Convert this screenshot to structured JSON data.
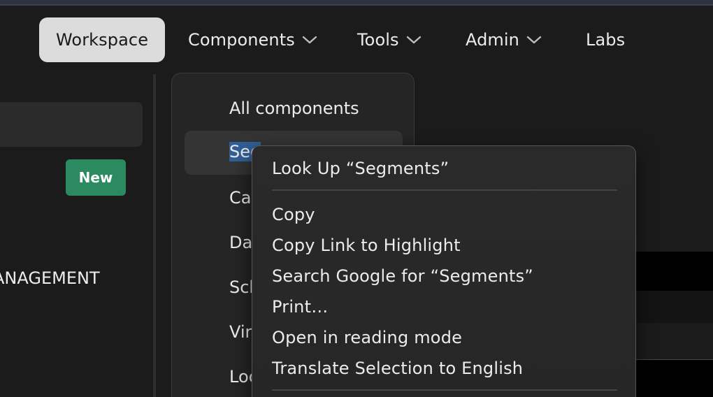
{
  "nav": {
    "items": [
      {
        "label": "Workspace",
        "active": true
      },
      {
        "label": "Components",
        "dropdown": true
      },
      {
        "label": "Tools",
        "dropdown": true
      },
      {
        "label": "Admin",
        "dropdown": true
      },
      {
        "label": "Labs"
      }
    ]
  },
  "sidebar": {
    "new_button": "New",
    "section_label": "ANAGEMENT"
  },
  "components_menu": {
    "items": [
      {
        "label": "All components"
      },
      {
        "label": "Seg",
        "selected_text": "Segments",
        "highlighted": true
      },
      {
        "label": "Cal"
      },
      {
        "label": "Dat"
      },
      {
        "label": "Sch"
      },
      {
        "label": "Vir"
      },
      {
        "label": "Loc"
      }
    ]
  },
  "context_menu": {
    "items": [
      {
        "label": "Look Up “Segments”"
      },
      {
        "label": "Copy"
      },
      {
        "label": "Copy Link to Highlight"
      },
      {
        "label": "Search Google for “Segments”"
      },
      {
        "label": "Print…"
      },
      {
        "label": "Open in reading mode"
      },
      {
        "label": "Translate Selection to English"
      }
    ]
  },
  "colors": {
    "accent_green": "#2b8a5f",
    "selection_blue": "#315f97",
    "active_nav_bg": "#dcdcdc"
  }
}
